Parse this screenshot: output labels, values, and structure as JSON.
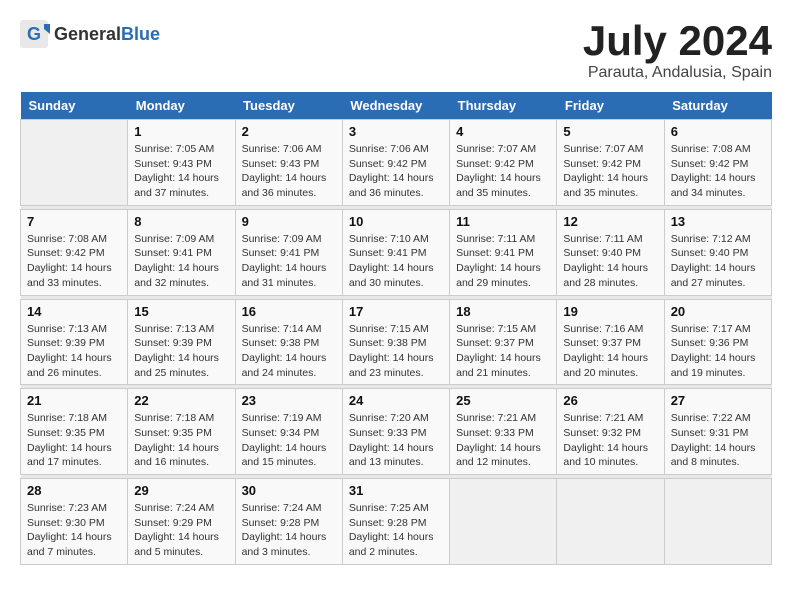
{
  "header": {
    "logo_general": "General",
    "logo_blue": "Blue",
    "month_year": "July 2024",
    "location": "Parauta, Andalusia, Spain"
  },
  "days_of_week": [
    "Sunday",
    "Monday",
    "Tuesday",
    "Wednesday",
    "Thursday",
    "Friday",
    "Saturday"
  ],
  "weeks": [
    [
      {
        "day": "",
        "sunrise": "",
        "sunset": "",
        "daylight": ""
      },
      {
        "day": "1",
        "sunrise": "Sunrise: 7:05 AM",
        "sunset": "Sunset: 9:43 PM",
        "daylight": "Daylight: 14 hours and 37 minutes."
      },
      {
        "day": "2",
        "sunrise": "Sunrise: 7:06 AM",
        "sunset": "Sunset: 9:43 PM",
        "daylight": "Daylight: 14 hours and 36 minutes."
      },
      {
        "day": "3",
        "sunrise": "Sunrise: 7:06 AM",
        "sunset": "Sunset: 9:42 PM",
        "daylight": "Daylight: 14 hours and 36 minutes."
      },
      {
        "day": "4",
        "sunrise": "Sunrise: 7:07 AM",
        "sunset": "Sunset: 9:42 PM",
        "daylight": "Daylight: 14 hours and 35 minutes."
      },
      {
        "day": "5",
        "sunrise": "Sunrise: 7:07 AM",
        "sunset": "Sunset: 9:42 PM",
        "daylight": "Daylight: 14 hours and 35 minutes."
      },
      {
        "day": "6",
        "sunrise": "Sunrise: 7:08 AM",
        "sunset": "Sunset: 9:42 PM",
        "daylight": "Daylight: 14 hours and 34 minutes."
      }
    ],
    [
      {
        "day": "7",
        "sunrise": "Sunrise: 7:08 AM",
        "sunset": "Sunset: 9:42 PM",
        "daylight": "Daylight: 14 hours and 33 minutes."
      },
      {
        "day": "8",
        "sunrise": "Sunrise: 7:09 AM",
        "sunset": "Sunset: 9:41 PM",
        "daylight": "Daylight: 14 hours and 32 minutes."
      },
      {
        "day": "9",
        "sunrise": "Sunrise: 7:09 AM",
        "sunset": "Sunset: 9:41 PM",
        "daylight": "Daylight: 14 hours and 31 minutes."
      },
      {
        "day": "10",
        "sunrise": "Sunrise: 7:10 AM",
        "sunset": "Sunset: 9:41 PM",
        "daylight": "Daylight: 14 hours and 30 minutes."
      },
      {
        "day": "11",
        "sunrise": "Sunrise: 7:11 AM",
        "sunset": "Sunset: 9:41 PM",
        "daylight": "Daylight: 14 hours and 29 minutes."
      },
      {
        "day": "12",
        "sunrise": "Sunrise: 7:11 AM",
        "sunset": "Sunset: 9:40 PM",
        "daylight": "Daylight: 14 hours and 28 minutes."
      },
      {
        "day": "13",
        "sunrise": "Sunrise: 7:12 AM",
        "sunset": "Sunset: 9:40 PM",
        "daylight": "Daylight: 14 hours and 27 minutes."
      }
    ],
    [
      {
        "day": "14",
        "sunrise": "Sunrise: 7:13 AM",
        "sunset": "Sunset: 9:39 PM",
        "daylight": "Daylight: 14 hours and 26 minutes."
      },
      {
        "day": "15",
        "sunrise": "Sunrise: 7:13 AM",
        "sunset": "Sunset: 9:39 PM",
        "daylight": "Daylight: 14 hours and 25 minutes."
      },
      {
        "day": "16",
        "sunrise": "Sunrise: 7:14 AM",
        "sunset": "Sunset: 9:38 PM",
        "daylight": "Daylight: 14 hours and 24 minutes."
      },
      {
        "day": "17",
        "sunrise": "Sunrise: 7:15 AM",
        "sunset": "Sunset: 9:38 PM",
        "daylight": "Daylight: 14 hours and 23 minutes."
      },
      {
        "day": "18",
        "sunrise": "Sunrise: 7:15 AM",
        "sunset": "Sunset: 9:37 PM",
        "daylight": "Daylight: 14 hours and 21 minutes."
      },
      {
        "day": "19",
        "sunrise": "Sunrise: 7:16 AM",
        "sunset": "Sunset: 9:37 PM",
        "daylight": "Daylight: 14 hours and 20 minutes."
      },
      {
        "day": "20",
        "sunrise": "Sunrise: 7:17 AM",
        "sunset": "Sunset: 9:36 PM",
        "daylight": "Daylight: 14 hours and 19 minutes."
      }
    ],
    [
      {
        "day": "21",
        "sunrise": "Sunrise: 7:18 AM",
        "sunset": "Sunset: 9:35 PM",
        "daylight": "Daylight: 14 hours and 17 minutes."
      },
      {
        "day": "22",
        "sunrise": "Sunrise: 7:18 AM",
        "sunset": "Sunset: 9:35 PM",
        "daylight": "Daylight: 14 hours and 16 minutes."
      },
      {
        "day": "23",
        "sunrise": "Sunrise: 7:19 AM",
        "sunset": "Sunset: 9:34 PM",
        "daylight": "Daylight: 14 hours and 15 minutes."
      },
      {
        "day": "24",
        "sunrise": "Sunrise: 7:20 AM",
        "sunset": "Sunset: 9:33 PM",
        "daylight": "Daylight: 14 hours and 13 minutes."
      },
      {
        "day": "25",
        "sunrise": "Sunrise: 7:21 AM",
        "sunset": "Sunset: 9:33 PM",
        "daylight": "Daylight: 14 hours and 12 minutes."
      },
      {
        "day": "26",
        "sunrise": "Sunrise: 7:21 AM",
        "sunset": "Sunset: 9:32 PM",
        "daylight": "Daylight: 14 hours and 10 minutes."
      },
      {
        "day": "27",
        "sunrise": "Sunrise: 7:22 AM",
        "sunset": "Sunset: 9:31 PM",
        "daylight": "Daylight: 14 hours and 8 minutes."
      }
    ],
    [
      {
        "day": "28",
        "sunrise": "Sunrise: 7:23 AM",
        "sunset": "Sunset: 9:30 PM",
        "daylight": "Daylight: 14 hours and 7 minutes."
      },
      {
        "day": "29",
        "sunrise": "Sunrise: 7:24 AM",
        "sunset": "Sunset: 9:29 PM",
        "daylight": "Daylight: 14 hours and 5 minutes."
      },
      {
        "day": "30",
        "sunrise": "Sunrise: 7:24 AM",
        "sunset": "Sunset: 9:28 PM",
        "daylight": "Daylight: 14 hours and 3 minutes."
      },
      {
        "day": "31",
        "sunrise": "Sunrise: 7:25 AM",
        "sunset": "Sunset: 9:28 PM",
        "daylight": "Daylight: 14 hours and 2 minutes."
      },
      {
        "day": "",
        "sunrise": "",
        "sunset": "",
        "daylight": ""
      },
      {
        "day": "",
        "sunrise": "",
        "sunset": "",
        "daylight": ""
      },
      {
        "day": "",
        "sunrise": "",
        "sunset": "",
        "daylight": ""
      }
    ]
  ]
}
